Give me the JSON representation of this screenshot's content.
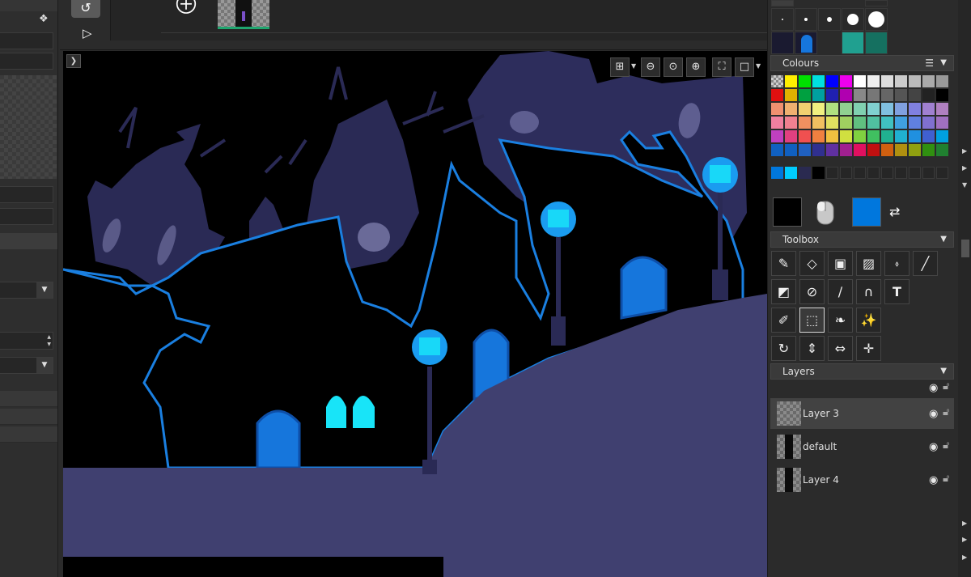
{
  "timeline": {
    "loop_icon": "loop-icon",
    "play_icon": "play-icon",
    "add_frame_icon": "add-frame-icon"
  },
  "canvas_toolbar": {
    "grid_icon": "grid-icon",
    "zoom_out_icon": "zoom-out-icon",
    "zoom_reset_icon": "zoom-reset-icon",
    "zoom_in_icon": "zoom-in-icon",
    "fit_icon": "fit-screen-icon",
    "frame_icon": "frame-mode-icon"
  },
  "panels": {
    "colours": {
      "title": "Colours"
    },
    "toolbox": {
      "title": "Toolbox"
    },
    "layers": {
      "title": "Layers"
    }
  },
  "palette": {
    "rows": [
      [
        "#cccccc",
        "#ffee00",
        "#00e000",
        "#00e0e0",
        "#0000ff",
        "#ee00ee",
        "#ffffff",
        "#eeeeee",
        "#dddddd",
        "#cccccc",
        "#bbbbbb",
        "#aaaaaa",
        "#999999"
      ],
      [
        "#e01010",
        "#e0b000",
        "#00a040",
        "#00a0a0",
        "#2020b0",
        "#b000b0",
        "#888888",
        "#777777",
        "#666666",
        "#555555",
        "#444444",
        "#222222",
        "#000000"
      ],
      [
        "#f09070",
        "#f0b070",
        "#f0d070",
        "#f0f080",
        "#b0e080",
        "#90d090",
        "#80d0b0",
        "#80d0d0",
        "#80c0e0",
        "#80a0e0",
        "#8080e0",
        "#a080d0",
        "#b080c0"
      ],
      [
        "#f080a0",
        "#f08090",
        "#f09060",
        "#f0c060",
        "#e0e060",
        "#a0d060",
        "#60c080",
        "#50c0a0",
        "#40c0c0",
        "#40a0e0",
        "#6080e0",
        "#8070d0",
        "#a070c0"
      ],
      [
        "#c040c0",
        "#e04080",
        "#f05050",
        "#f08040",
        "#f0c040",
        "#d0e040",
        "#80d040",
        "#40c060",
        "#20b090",
        "#20b0d0",
        "#2090e0",
        "#4060d0",
        "#00a0e0"
      ],
      [
        "#1060c0",
        "#1060c0",
        "#2060c0",
        "#303090",
        "#6030a0",
        "#a02090",
        "#e01060",
        "#c01010",
        "#d06010",
        "#b09010",
        "#90a010",
        "#309010",
        "#208030"
      ]
    ],
    "recent": [
      "#0077dd",
      "#00ccff",
      "#2a2a50",
      "#000000"
    ],
    "primary_color": "#000000",
    "secondary_color": "#0077dd"
  },
  "tools": {
    "row1": [
      "pencil-icon",
      "eraser-icon",
      "select-rect-add-icon",
      "select-rect-sub-icon",
      "bucket-icon",
      "line-icon"
    ],
    "row2": [
      "shade-icon",
      "circle-fill-icon",
      "no-draw-icon",
      "curve-icon",
      "text-icon"
    ],
    "row3": [
      "eyedropper-icon",
      "marquee-icon",
      "lasso-icon",
      "magic-wand-icon"
    ],
    "row4": [
      "rotate-icon",
      "flip-v-icon",
      "flip-h-icon",
      "move-icon"
    ]
  },
  "layers": [
    {
      "name": "Layer 3",
      "selected": true
    },
    {
      "name": "default",
      "selected": false
    },
    {
      "name": "Layer 4",
      "selected": false
    }
  ]
}
